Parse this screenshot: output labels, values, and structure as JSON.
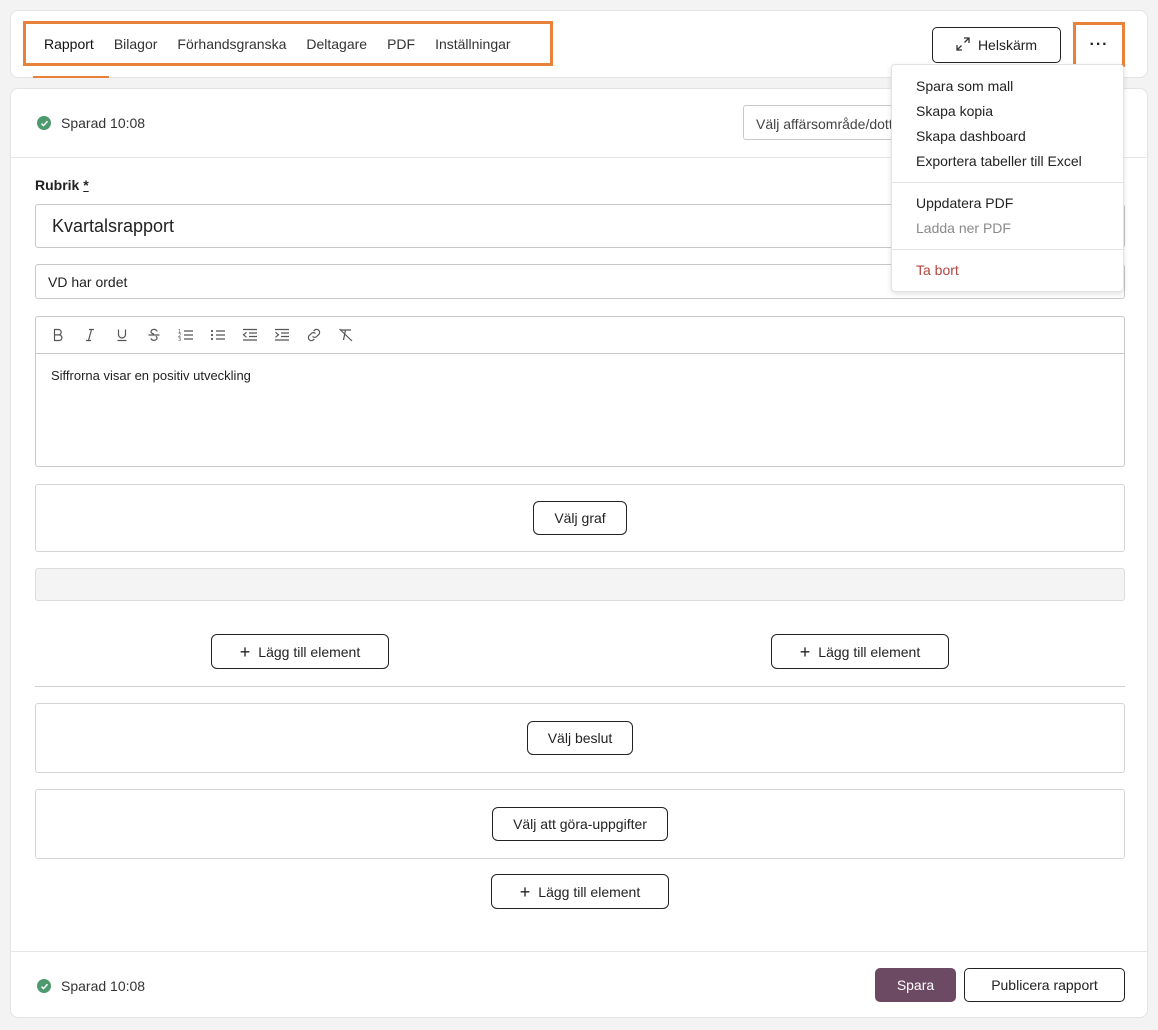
{
  "tabs": [
    "Rapport",
    "Bilagor",
    "Förhandsgranska",
    "Deltagare",
    "PDF",
    "Inställningar"
  ],
  "header": {
    "fullscreen_label": "Helskärm",
    "more_label": "···"
  },
  "status": {
    "saved_top": "Sparad 10:08",
    "saved_bottom": "Sparad 10:08"
  },
  "select": {
    "placeholder": "Välj affärsområde/dotterbolag"
  },
  "form": {
    "title_label": "Rubrik",
    "required_mark": "*",
    "title_value": "Kvartalsrapport",
    "subtitle_value": "VD har ordet",
    "body_text": "Siffrorna visar en positiv utveckling"
  },
  "toolbar_icons": [
    "bold-icon",
    "italic-icon",
    "underline-icon",
    "strikethrough-icon",
    "ordered-list-icon",
    "bullet-list-icon",
    "outdent-icon",
    "indent-icon",
    "link-icon",
    "clear-format-icon"
  ],
  "blocks": {
    "choose_chart": "Välj graf",
    "add_element": "Lägg till element",
    "choose_decision": "Välj beslut",
    "choose_todo": "Välj att göra-uppgifter"
  },
  "footer": {
    "save_label": "Spara",
    "publish_label": "Publicera rapport"
  },
  "menu": {
    "group1": [
      "Spara som mall",
      "Skapa kopia",
      "Skapa dashboard",
      "Exportera tabeller till Excel"
    ],
    "group2": [
      "Uppdatera PDF",
      "Ladda ner PDF"
    ],
    "group3": [
      "Ta bort"
    ]
  },
  "colors": {
    "accent": "#e8813a",
    "primary": "#6d4a63",
    "success": "#4e9a6f",
    "danger": "#b5443f"
  }
}
